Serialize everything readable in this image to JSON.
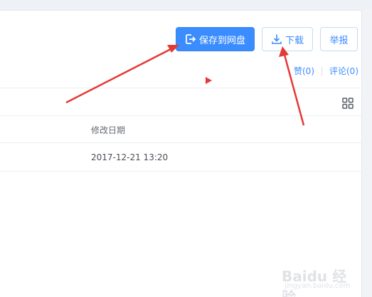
{
  "toolbar": {
    "save_label": "保存到网盘",
    "download_label": "下载",
    "report_label": "举报"
  },
  "meta": {
    "like_label": "赞(0)",
    "comment_label": "评论(0)"
  },
  "table": {
    "columns": [
      "修改日期"
    ],
    "rows": [
      {
        "modified": "2017-12-21 13:20"
      }
    ]
  },
  "watermark": {
    "text": "Baidu 经验",
    "subtext": "jingyan.baidu.com"
  },
  "colors": {
    "accent": "#3b8cff",
    "annotation_red": "#e53935"
  },
  "icons": {
    "save": "save-to-cloud-icon",
    "download": "download-icon",
    "view_toggle": "grid-view-icon"
  }
}
